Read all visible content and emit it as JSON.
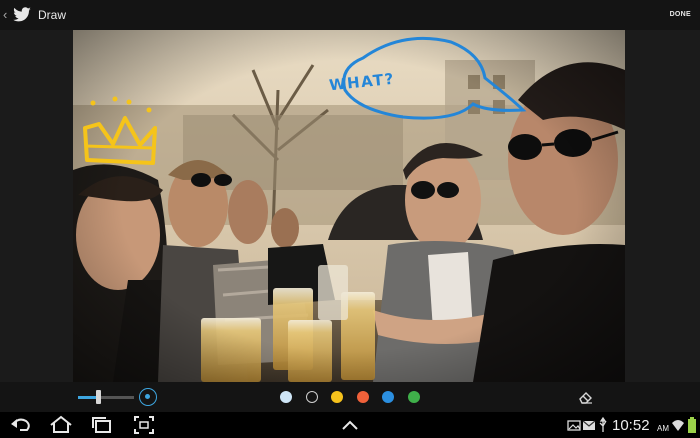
{
  "app": {
    "back_icon": "chevron-left-icon",
    "logo_icon": "twitter-bird-icon",
    "title": "Draw",
    "done_label": "DONE"
  },
  "canvas": {
    "annotation_text": "WHAT?",
    "annotation_color": "#2486d8",
    "crown_color": "#f5c41a"
  },
  "toolbar": {
    "brush_size_fraction": 0.35,
    "accent_color": "#3da6e0",
    "colors": [
      {
        "name": "light-blue",
        "hex": "#cfe6f7",
        "selected": false
      },
      {
        "name": "black",
        "hex": "#111111",
        "selected": true
      },
      {
        "name": "yellow",
        "hex": "#f6c21c",
        "selected": false
      },
      {
        "name": "orange",
        "hex": "#f0613a",
        "selected": false
      },
      {
        "name": "blue",
        "hex": "#2b8fe0",
        "selected": false
      },
      {
        "name": "green",
        "hex": "#3fb04a",
        "selected": false
      }
    ],
    "eraser_icon": "eraser-icon"
  },
  "navbar": {
    "icons": [
      "back-icon",
      "home-icon",
      "recent-apps-icon",
      "screenshot-icon",
      "caret-up-icon"
    ],
    "status_icons": [
      "gallery-icon",
      "mail-icon",
      "usb-icon"
    ],
    "time": "10:52",
    "ampm": "AM",
    "wifi_icon": "wifi-icon",
    "battery_icon": "battery-icon"
  }
}
